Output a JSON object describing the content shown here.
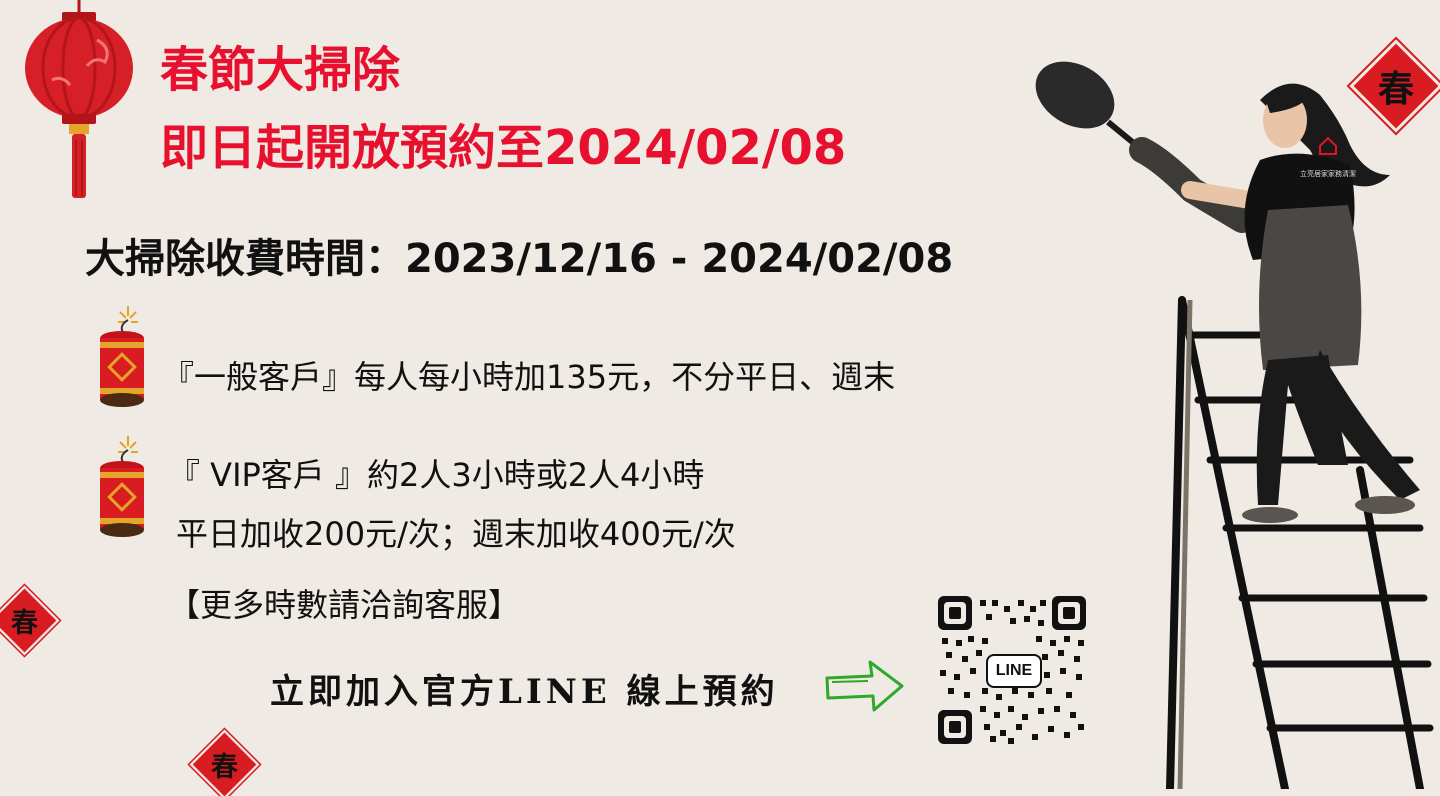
{
  "headline": {
    "line1": "春節大掃除",
    "line2": "即日起開放預約至2024/02/08"
  },
  "period": "大掃除收費時間：2023/12/16 - 2024/02/08",
  "items": [
    {
      "text": "『一般客戶』每人每小時加135元，不分平日、週末"
    },
    {
      "text": "『 VIP客戶 』約2人3小時或2人4小時"
    },
    {
      "text": "平日加收200元/次；週末加收400元/次"
    }
  ],
  "note": "【更多時數請洽詢客服】",
  "cta": "立即加入官方LINE 線上預約",
  "qr": {
    "center_label": "LINE"
  },
  "decor": {
    "spring_char": "春",
    "shirt_logo_text": "立亮居家家務清潔"
  },
  "colors": {
    "accent_red": "#e8102f",
    "background": "#efebe4",
    "arrow_green": "#2fa82a"
  }
}
